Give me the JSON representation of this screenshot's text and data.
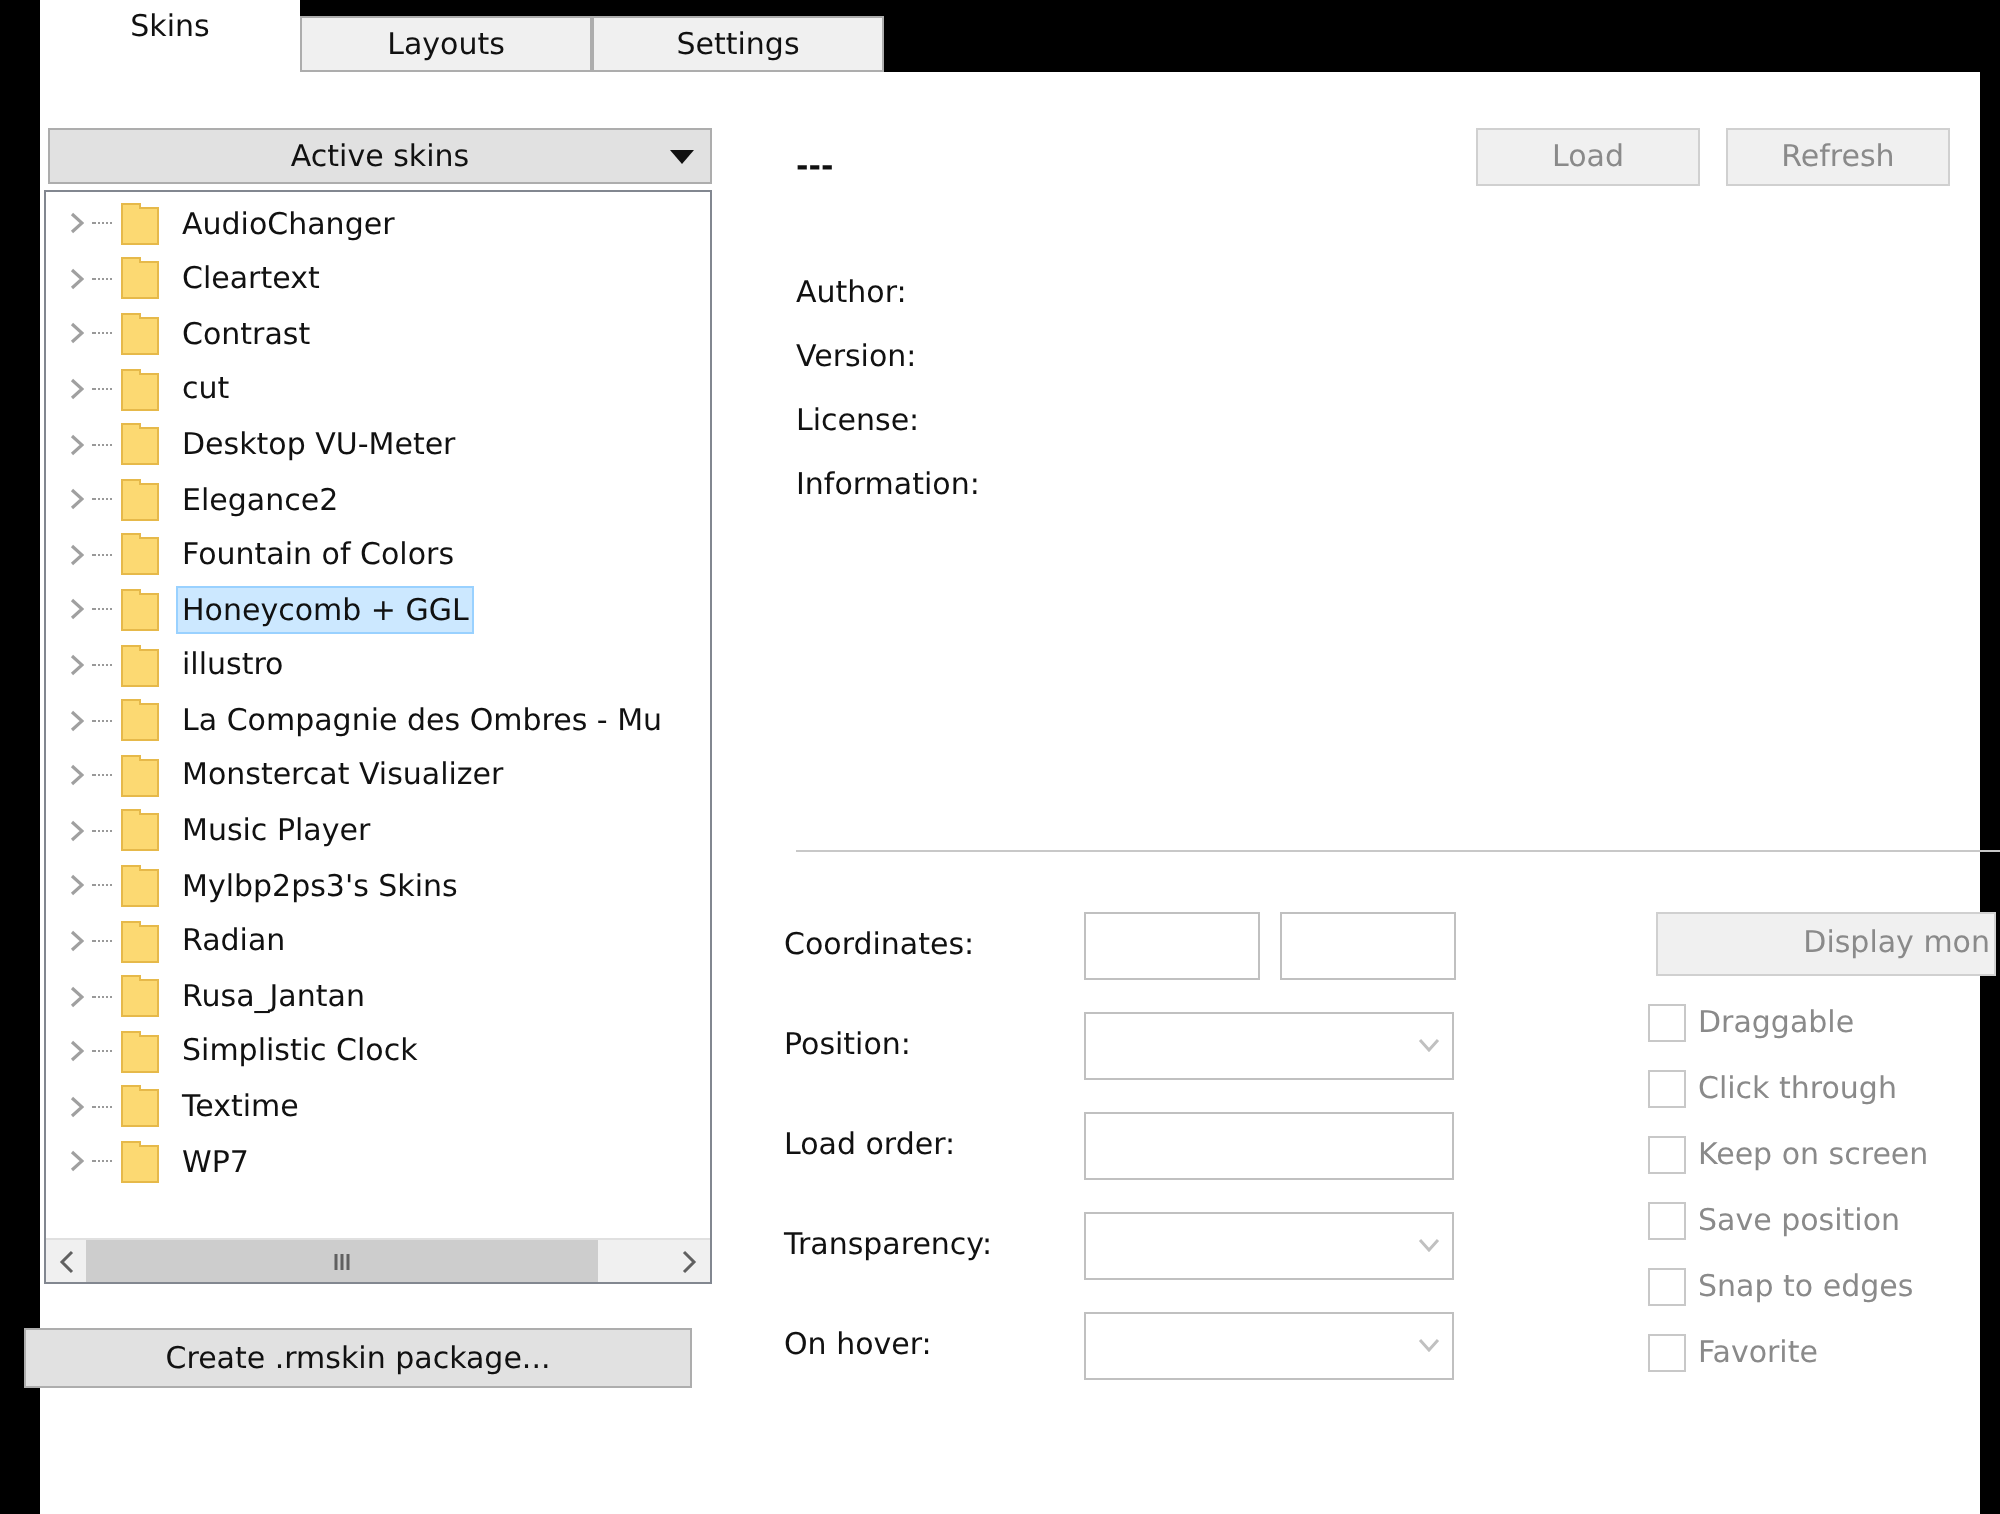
{
  "tabs": [
    {
      "label": "Skins",
      "selected": true
    },
    {
      "label": "Layouts",
      "selected": false
    },
    {
      "label": "Settings",
      "selected": false
    }
  ],
  "skin_filter": {
    "label": "Active skins"
  },
  "skins_tree": {
    "items": [
      {
        "label": "AudioChanger",
        "selected": false
      },
      {
        "label": "Cleartext",
        "selected": false
      },
      {
        "label": "Contrast",
        "selected": false
      },
      {
        "label": "cut",
        "selected": false
      },
      {
        "label": "Desktop VU-Meter",
        "selected": false
      },
      {
        "label": "Elegance2",
        "selected": false
      },
      {
        "label": "Fountain of Colors",
        "selected": false
      },
      {
        "label": "Honeycomb + GGL",
        "selected": true
      },
      {
        "label": "illustro",
        "selected": false
      },
      {
        "label": "La Compagnie des Ombres - Mu",
        "selected": false
      },
      {
        "label": "Monstercat Visualizer",
        "selected": false
      },
      {
        "label": "Music Player",
        "selected": false
      },
      {
        "label": "Mylbp2ps3's Skins",
        "selected": false
      },
      {
        "label": "Radian",
        "selected": false
      },
      {
        "label": "Rusa_Jantan",
        "selected": false
      },
      {
        "label": "Simplistic Clock",
        "selected": false
      },
      {
        "label": "Textime",
        "selected": false
      },
      {
        "label": "WP7",
        "selected": false
      }
    ]
  },
  "create_package_button": "Create .rmskin package...",
  "skin_name": "---",
  "action_buttons": [
    {
      "label": "Load",
      "disabled": true
    },
    {
      "label": "Refresh",
      "disabled": true
    }
  ],
  "info_labels": [
    "Author:",
    "Version:",
    "License:",
    "Information:"
  ],
  "settings": [
    {
      "label": "Coordinates:",
      "kind": "pair"
    },
    {
      "label": "Position:",
      "kind": "dropdown"
    },
    {
      "label": "Load order:",
      "kind": "text"
    },
    {
      "label": "Transparency:",
      "kind": "dropdown"
    },
    {
      "label": "On hover:",
      "kind": "dropdown"
    }
  ],
  "display_monitor_button": "Display mon",
  "options": [
    {
      "label": "Draggable",
      "checked": false,
      "disabled": true
    },
    {
      "label": "Click through",
      "checked": false,
      "disabled": true
    },
    {
      "label": "Keep on screen",
      "checked": false,
      "disabled": true
    },
    {
      "label": "Save position",
      "checked": false,
      "disabled": true
    },
    {
      "label": "Snap to edges",
      "checked": false,
      "disabled": true
    },
    {
      "label": "Favorite",
      "checked": false,
      "disabled": true
    }
  ]
}
